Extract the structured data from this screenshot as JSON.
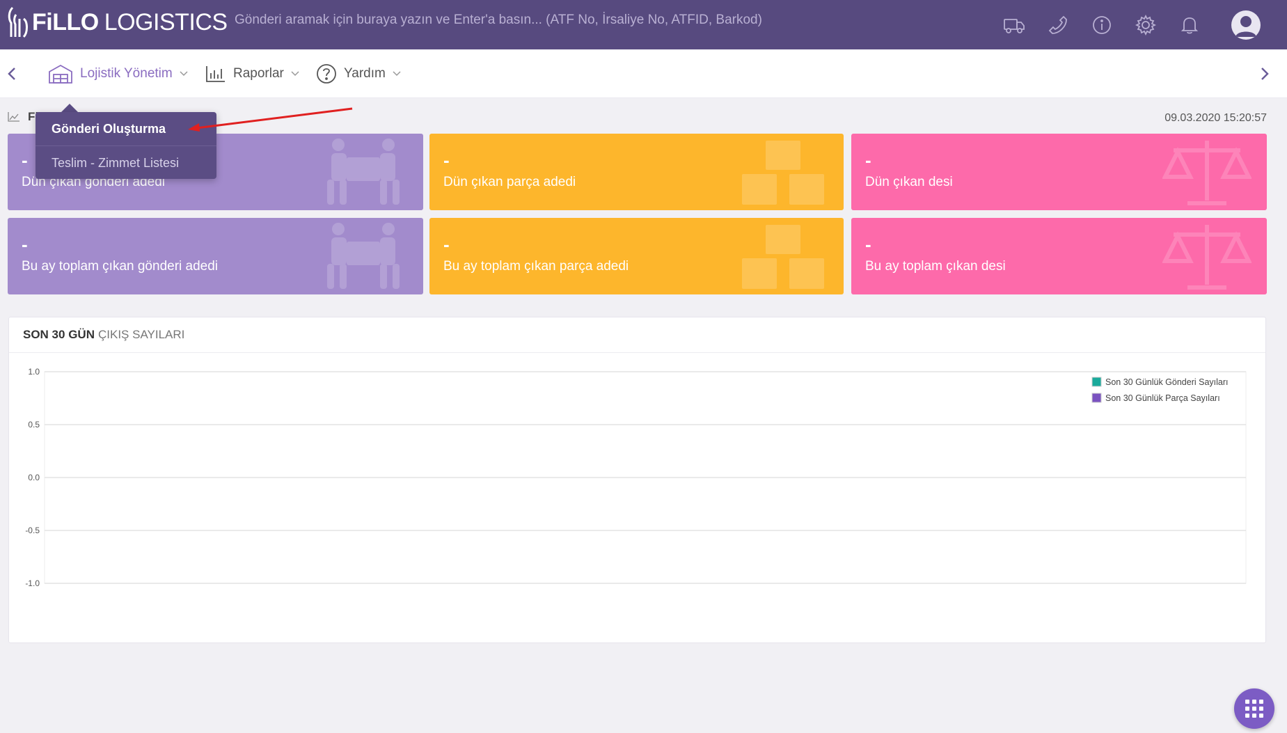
{
  "topbar": {
    "logo_bold": "FiLLO",
    "logo_light": "LOGISTICS",
    "search_placeholder": "Gönderi aramak için buraya yazın ve Enter'a basın... (ATF No, İrsaliye No, ATFID, Barkod)",
    "icons": [
      "truck-icon",
      "phone-icon",
      "info-icon",
      "gear-icon",
      "bell-icon",
      "user-avatar"
    ]
  },
  "nav": {
    "items": [
      {
        "label": "Lojistik Yönetim",
        "icon": "warehouse-icon"
      },
      {
        "label": "Raporlar",
        "icon": "bar-chart-icon"
      },
      {
        "label": "Yardım",
        "icon": "help-circle-icon"
      }
    ]
  },
  "dropdown": {
    "items": [
      "Gönderi Oluşturma",
      "Teslim - Zimmet Listesi"
    ]
  },
  "header": {
    "crumb": "Fi",
    "timestamp": "09.03.2020 15:20:57"
  },
  "cards": [
    {
      "value": "-",
      "label": "Dün çıkan gönderi adedi",
      "color": "#a28bcc",
      "icon": "people-carrying-box-icon"
    },
    {
      "value": "-",
      "label": "Dün çıkan parça adedi",
      "color": "#fdb62c",
      "icon": "boxes-icon"
    },
    {
      "value": "-",
      "label": "Dün çıkan desi",
      "color": "#fd6aaa",
      "icon": "balance-scale-icon"
    },
    {
      "value": "-",
      "label": "Bu ay toplam çıkan gönderi adedi",
      "color": "#a28bcc",
      "icon": "people-carrying-box-icon"
    },
    {
      "value": "-",
      "label": "Bu ay toplam çıkan parça adedi",
      "color": "#fdb62c",
      "icon": "boxes-icon"
    },
    {
      "value": "-",
      "label": "Bu ay toplam çıkan desi",
      "color": "#fd6aaa",
      "icon": "balance-scale-icon"
    }
  ],
  "panel": {
    "title_bold": "SON 30 GÜN",
    "title_normal": "ÇIKIŞ SAYILARI"
  },
  "chart_data": {
    "type": "line",
    "ylim": [
      -1.0,
      1.0
    ],
    "yticks": [
      "1.0",
      "0.5",
      "0.0",
      "-0.5",
      "-1.0"
    ],
    "ytick_values": [
      1.0,
      0.5,
      0.0,
      -0.5,
      -1.0
    ],
    "grid": true,
    "legend_position": "top-right",
    "series": [
      {
        "name": "Son 30 Günlük Gönderi Sayıları",
        "color": "#1aaa9b",
        "values": []
      },
      {
        "name": "Son 30 Günlük Parça Sayıları",
        "color": "#7a52c0",
        "values": []
      }
    ]
  }
}
